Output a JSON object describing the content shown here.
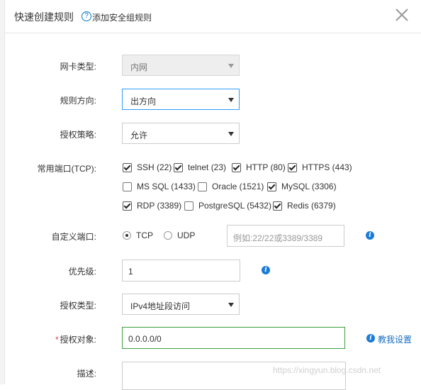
{
  "header": {
    "title": "快速创建规则",
    "help_link": "添加安全组规则",
    "close_label": "×"
  },
  "form": {
    "nic_type": {
      "label": "网卡类型:",
      "value": "内网"
    },
    "direction": {
      "label": "规则方向:",
      "value": "出方向"
    },
    "policy": {
      "label": "授权策略:",
      "value": "允许"
    },
    "ports": {
      "label": "常用端口(TCP):",
      "options": [
        {
          "label": "SSH (22)",
          "checked": true
        },
        {
          "label": "telnet (23)",
          "checked": true
        },
        {
          "label": "HTTP (80)",
          "checked": true
        },
        {
          "label": "HTTPS (443)",
          "checked": true
        },
        {
          "label": "MS SQL (1433)",
          "checked": false
        },
        {
          "label": "Oracle (1521)",
          "checked": false
        },
        {
          "label": "MySQL (3306)",
          "checked": true
        },
        {
          "label": "RDP (3389)",
          "checked": true
        },
        {
          "label": "PostgreSQL (5432)",
          "checked": false
        },
        {
          "label": "Redis (6379)",
          "checked": true
        }
      ]
    },
    "custom_port": {
      "label": "自定义端口:",
      "protocols": [
        {
          "label": "TCP",
          "selected": true
        },
        {
          "label": "UDP",
          "selected": false
        }
      ],
      "placeholder": "例如:22/22或3389/3389"
    },
    "priority": {
      "label": "优先级:",
      "value": "1"
    },
    "auth_type": {
      "label": "授权类型:",
      "value": "IPv4地址段访问"
    },
    "auth_object": {
      "label": "授权对象:",
      "required_mark": "*",
      "value": "0.0.0.0/0",
      "help": "教我设置"
    },
    "description": {
      "label": "描述:",
      "value": ""
    }
  },
  "watermark": "https://xingyun.blog.csdn.net",
  "colors": {
    "accent": "#1a7cd6",
    "success_border": "#3e9f3e",
    "focus_border": "#2e9df8",
    "required": "#e4393c"
  }
}
